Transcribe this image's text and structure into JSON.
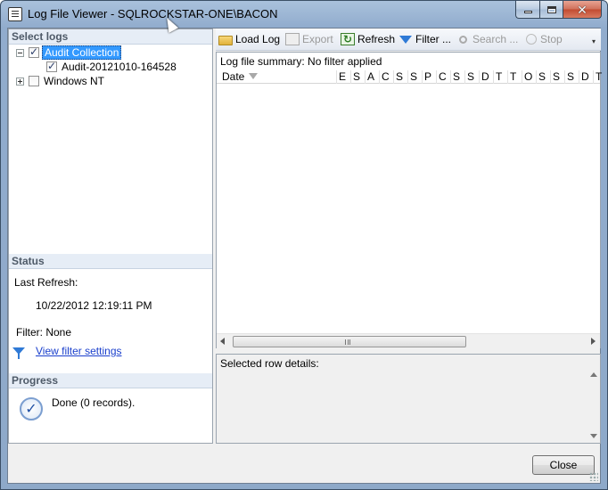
{
  "window": {
    "title": "Log File Viewer - SQLROCKSTAR-ONE\\BACON"
  },
  "left": {
    "select_logs_header": "Select logs",
    "tree": [
      {
        "label": "Audit Collection",
        "checked": true,
        "expanded": true,
        "selected": true
      },
      {
        "label": "Audit-20121010-164528",
        "checked": true
      },
      {
        "label": "Windows NT",
        "checked": false,
        "expanded": false
      }
    ],
    "status_header": "Status",
    "last_refresh_label": "Last Refresh:",
    "last_refresh_value": "10/22/2012 12:19:11 PM",
    "filter_label": "Filter: None",
    "view_filter_link": "View filter settings",
    "progress_header": "Progress",
    "progress_text": "Done (0 records)."
  },
  "toolbar": {
    "load_log": "Load Log",
    "export": "Export",
    "refresh": "Refresh",
    "filter": "Filter ...",
    "search": "Search ...",
    "stop": "Stop"
  },
  "grid": {
    "summary": "Log file summary: No filter applied",
    "date_column": "Date",
    "columns": [
      "E",
      "S",
      "A",
      "C",
      "S",
      "S",
      "P",
      "C",
      "S",
      "S",
      "D",
      "T",
      "T",
      "O",
      "S",
      "S",
      "S",
      "D",
      "T"
    ]
  },
  "details": {
    "label": "Selected row details:"
  },
  "footer": {
    "close_label": "Close"
  }
}
